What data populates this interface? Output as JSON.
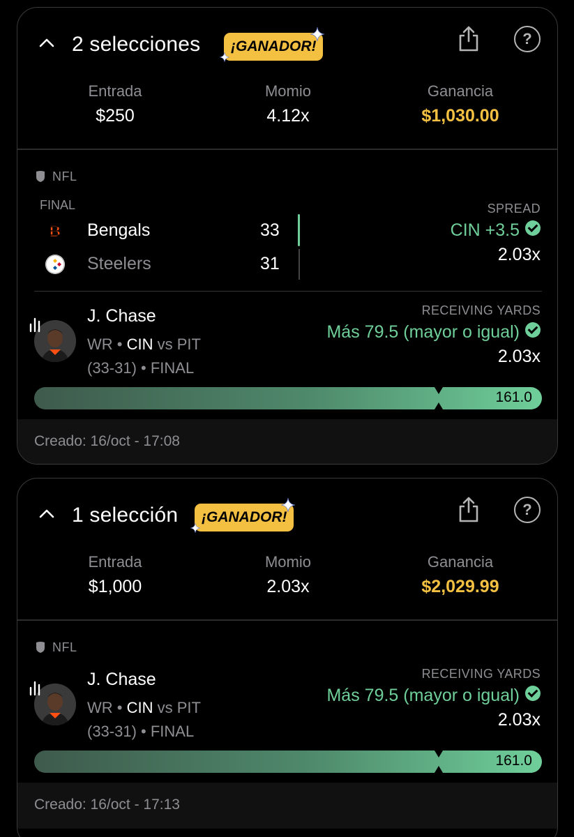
{
  "ticket1": {
    "title": "2 selecciones",
    "badge": "¡GANADOR!",
    "stats": {
      "entry_label": "Entrada",
      "entry_value": "$250",
      "odds_label": "Momio",
      "odds_value": "4.12x",
      "payout_label": "Ganancia",
      "payout_value": "$1,030.00"
    },
    "league": "NFL",
    "game": {
      "status": "FINAL",
      "team1": {
        "name": "Bengals",
        "score": "33"
      },
      "team2": {
        "name": "Steelers",
        "score": "31"
      },
      "market": "SPREAD",
      "pick": "CIN +3.5",
      "odds": "2.03x"
    },
    "prop": {
      "player": "J. Chase",
      "pos": "WR",
      "team": "CIN",
      "vs": "vs PIT",
      "result": "(33-31)",
      "status": "FINAL",
      "market": "RECEIVING YARDS",
      "pick": "Más 79.5 (mayor o igual)",
      "odds": "2.03x",
      "actual": "161.0"
    },
    "created": "Creado: 16/oct - 17:08"
  },
  "ticket2": {
    "title": "1 selección",
    "badge": "¡GANADOR!",
    "stats": {
      "entry_label": "Entrada",
      "entry_value": "$1,000",
      "odds_label": "Momio",
      "odds_value": "2.03x",
      "payout_label": "Ganancia",
      "payout_value": "$2,029.99"
    },
    "league": "NFL",
    "prop": {
      "player": "J. Chase",
      "pos": "WR",
      "team": "CIN",
      "vs": "vs PIT",
      "result": "(33-31)",
      "status": "FINAL",
      "market": "RECEIVING YARDS",
      "pick": "Más 79.5 (mayor o igual)",
      "odds": "2.03x",
      "actual": "161.0"
    },
    "created": "Creado: 16/oct - 17:13"
  },
  "colors": {
    "win_green": "#6fcf9a",
    "gold": "#f3c042",
    "muted": "#8e8e93"
  },
  "icons": [
    "chevron-up-icon",
    "share-icon",
    "help-icon",
    "sparkle-icon",
    "nfl-shield-icon",
    "bengals-logo",
    "steelers-logo",
    "stats-chart-icon",
    "check-circle-icon"
  ]
}
